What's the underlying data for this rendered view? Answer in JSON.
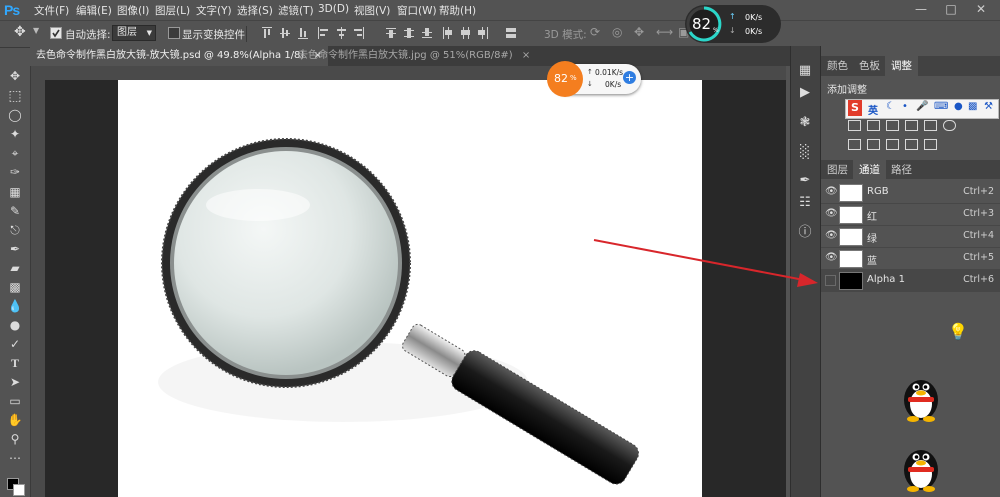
{
  "app": {
    "logo": "Ps"
  },
  "menu": [
    "文件(F)",
    "编辑(E)",
    "图像(I)",
    "图层(L)",
    "文字(Y)",
    "选择(S)",
    "滤镜(T)",
    "3D(D)",
    "视图(V)",
    "窗口(W)",
    "帮助(H)"
  ],
  "options": {
    "auto_select_label": "自动选择:",
    "auto_select_value": "图层",
    "show_transform_label": "显示变换控件",
    "mode_3d_label": "3D 模式:"
  },
  "tabs": [
    {
      "label": "去色命令制作黑白放大镜-放大镜.psd @ 49.8%(Alpha 1/8)",
      "close": "×"
    },
    {
      "label": "去色命令制作黑白放大镜.jpg @ 51%(RGB/8#)",
      "close": "×"
    }
  ],
  "panel": {
    "top_tabs": [
      "颜色",
      "色板",
      "调整"
    ],
    "adjust_title": "添加调整",
    "channel_tabs": [
      "图层",
      "通道",
      "路径"
    ],
    "channels": [
      {
        "name": "RGB",
        "shortcut": "Ctrl+2"
      },
      {
        "name": "红",
        "shortcut": "Ctrl+3"
      },
      {
        "name": "绿",
        "shortcut": "Ctrl+4"
      },
      {
        "name": "蓝",
        "shortcut": "Ctrl+5"
      },
      {
        "name": "Alpha 1",
        "shortcut": "Ctrl+6"
      }
    ]
  },
  "net_monitor_1": {
    "percent": "82",
    "unit": "%",
    "up": "0.01K/s",
    "down": "0K/s"
  },
  "net_monitor_2": {
    "percent": "82",
    "unit": "%",
    "up": "0K/s",
    "down": "0K/s"
  },
  "sogou": {
    "label": "英"
  },
  "colors": {
    "accent": "#31a8ff",
    "annotation_arrow": "#d8262b",
    "monitor": "#f47e1f"
  }
}
